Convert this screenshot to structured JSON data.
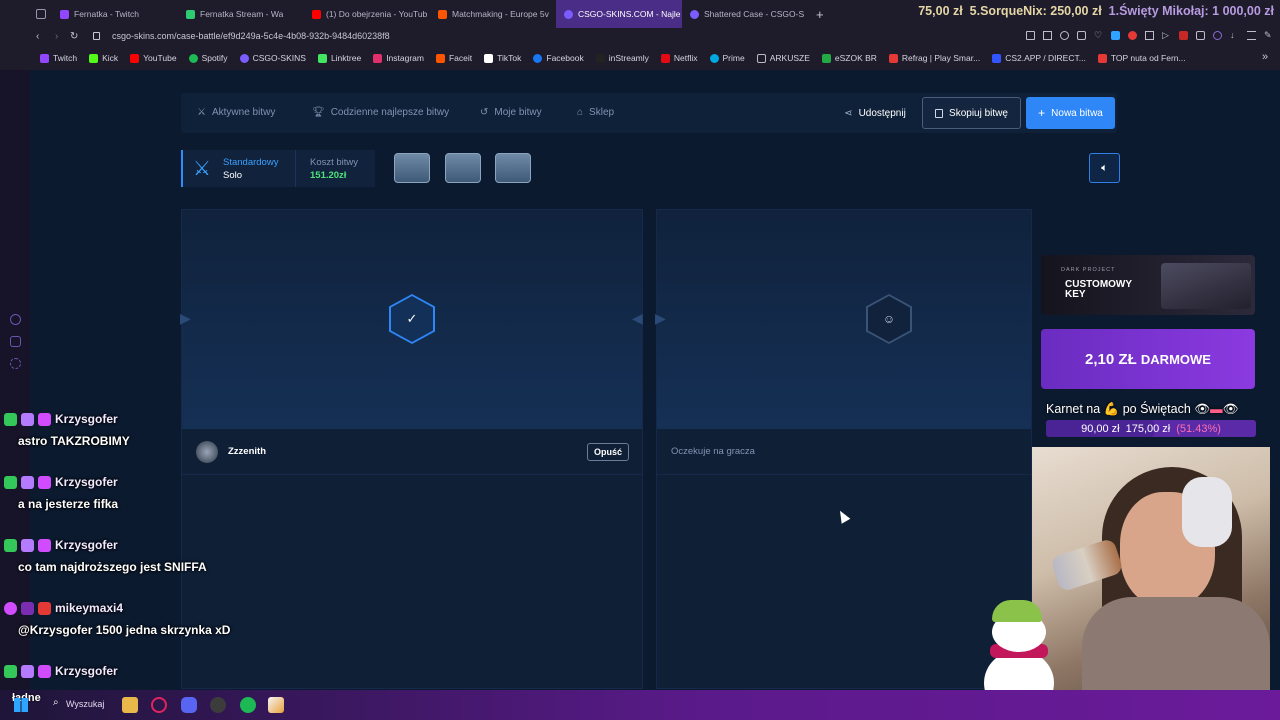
{
  "browser": {
    "tabs": [
      {
        "label": "Fernatka - Twitch",
        "color": "#9147ff"
      },
      {
        "label": "Fernatka Stream - Wa",
        "color": "#2ecc71"
      },
      {
        "label": "(1) Do obejrzenia - YouTub",
        "color": "#ff0000"
      },
      {
        "label": "Matchmaking - Europe 5v",
        "color": "#ff5500"
      },
      {
        "label": "CSGO-SKINS.COM - Najle",
        "color": "#7b5cff",
        "active": true
      },
      {
        "label": "Shattered Case - CSGO-S",
        "color": "#7b5cff"
      }
    ],
    "new_tab_icon": "plus-icon",
    "url": "csgo-skins.com/case-battle/ef9d249a-5c4e-4b08-932b-9484d60238f8",
    "bookmarks": [
      {
        "label": "Twitch",
        "color": "#9147ff"
      },
      {
        "label": "Kick",
        "color": "#53fc18"
      },
      {
        "label": "YouTube",
        "color": "#ff0000"
      },
      {
        "label": "Spotify",
        "color": "#1db954"
      },
      {
        "label": "CSGO-SKINS",
        "color": "#7b5cff"
      },
      {
        "label": "Linktree",
        "color": "#43e660"
      },
      {
        "label": "Instagram",
        "color": "#e1306c"
      },
      {
        "label": "Faceit",
        "color": "#ff5500"
      },
      {
        "label": "TikTok",
        "color": "#ffffff"
      },
      {
        "label": "Facebook",
        "color": "#1877f2"
      },
      {
        "label": "inStreamly",
        "color": "#222222"
      },
      {
        "label": "Netflix",
        "color": "#e50914"
      },
      {
        "label": "Prime",
        "color": "#00a8e1"
      },
      {
        "label": "ARKUSZE",
        "color": "#bbbbbb"
      },
      {
        "label": "eSZOK BR",
        "color": "#22aa44"
      },
      {
        "label": "Refrag | Play Smar...",
        "color": "#e53935"
      },
      {
        "label": "CS2.APP / DIRECT...",
        "color": "#3355ff"
      },
      {
        "label": "TOP nuta od Fern...",
        "color": "#e53935"
      }
    ]
  },
  "ticker": {
    "a": "75,00 zł",
    "b": "5.SorqueNix: 250,00 zł",
    "c": "1.Święty Mikołaj: 1 000,00 zł"
  },
  "nav": {
    "active_battles": "Aktywne bitwy",
    "daily_best": "Codzienne najlepsze bitwy",
    "my_battles": "Moje bitwy",
    "shop": "Sklep",
    "share": "Udostępnij",
    "copy_battle": "Skopiuj bitwę",
    "new_battle": "Nowa bitwa"
  },
  "battle": {
    "mode_label": "Standardowy",
    "mode_value": "Solo",
    "cost_label": "Koszt bitwy",
    "cost_value": "151.20zł",
    "player_name": "Zzzenith",
    "leave_button": "Opuść",
    "waiting_text": "Oczekuje na gracza"
  },
  "chat": [
    {
      "user": "Krzysgofer",
      "message": "astro TAKZROBIMY"
    },
    {
      "user": "Krzysgofer",
      "message": "a na jesterze fifka"
    },
    {
      "user": "Krzysgofer",
      "message": "co tam najdroższego jest SNIFFA"
    },
    {
      "user": "mikeymaxi4",
      "message": "@Krzysgofer 1500 jedna skrzynka xD"
    },
    {
      "user": "Krzysgofer",
      "message": ""
    }
  ],
  "overlay": {
    "promo1_small": "DARK PROJECT",
    "promo1_title": "CUSTOMOWY KEY",
    "promo2_amount": "2,10 ZŁ",
    "promo2_word": "DARMOWE",
    "karnet": "Karnet na 💪 po Świętach",
    "karnet_current": "90,00 zł",
    "karnet_goal": "175,00 zł",
    "karnet_pct": "(51.43%)"
  },
  "taskbar": {
    "search_placeholder": "Wyszukaj",
    "weather": "ładne"
  }
}
